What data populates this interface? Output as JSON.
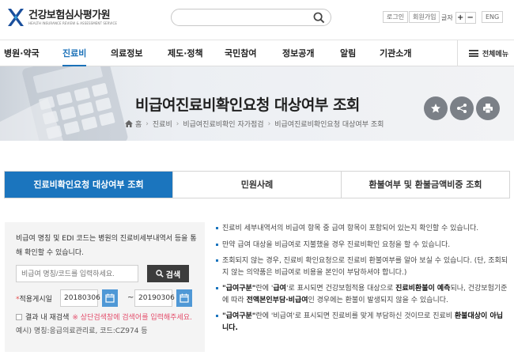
{
  "header": {
    "logo_kor": "건강보험심사평가원",
    "logo_eng": "HEALTH INSURANCE REVIEW & ASSESSMENT SERVICE",
    "search_placeholder": "",
    "login": "로그인",
    "join": "회원가입",
    "font_size_label": "글자",
    "font_plus": "+",
    "font_minus": "−",
    "lang": "ENG"
  },
  "nav": {
    "items": [
      "병원·약국",
      "진료비",
      "의료정보",
      "제도·정책",
      "국민참여",
      "정보공개",
      "알림",
      "기관소개"
    ],
    "active_index": 1,
    "all_menu": "전체메뉴"
  },
  "banner": {
    "title": "비급여진료비확인요청 대상여부 조회",
    "breadcrumb": [
      "홈",
      "진료비",
      "비급여진료비확인 자가점검",
      "비급여진료비확인요청 대상여부 조회"
    ]
  },
  "icons": {
    "favorite": "star-icon",
    "share": "share-icon",
    "print": "print-icon"
  },
  "tabs": [
    "진료비확인요청 대상여부 조회",
    "민원사례",
    "환불여부 및 환불금액비중 조회"
  ],
  "search_panel": {
    "description": "비급여 명칭 및 EDI 코드는 병원의 진료비세부내역서 등을 통해 확인할 수 있습니다.",
    "keyword_placeholder": "비급여 명칭/코드를 입력하세요.",
    "search_button": "검색",
    "date_label_star": "*",
    "date_label": "적용게시일",
    "date_from": "20180306",
    "date_to": "20190306",
    "tilde": "~",
    "checkbox_label": "결과 내 재검색",
    "checkbox_warning": "※ 상단검색창에 검색어를 입력해주세요.",
    "example": "예시) 명칭:응급의료관리료, 코드:CZ974 등"
  },
  "info": [
    {
      "plain": "진료비 세부내역서의 비급여 항목 중 급여 항목이 포함되어 있는지 확인할 수 있습니다."
    },
    {
      "plain": "만약 급여 대상을 비급여로 지불했을 경우 진료비확인 요청을 할 수 있습니다."
    },
    {
      "plain": "조회되지 않는 경우, 진료비 확인요청으로 진료비 환불여부를 알아 보실 수 있습니다. (단, 조회되지 않는 의약품은 비급여로 비용을 본인이 부담하셔야 합니다.)"
    },
    {
      "b1": "\"급여구분\"",
      "t1": "란에 '",
      "b2": "급여",
      "t2": "'로 표시되면 건강보험적용 대상으로 ",
      "b3": "진료비환불이 예측",
      "t3": "되나, 건강보험기준에 따라 ",
      "b4": "전액본인부담·비급여",
      "t4": "인 경우에는 환불이 발생되지 않을 수 있습니다."
    },
    {
      "b1": "\"급여구분\"",
      "t1": "란에 '비급여'로 표시되면 진료비를 맞게 부담하신 것이므로 진료비 ",
      "b2": "환불대상이 아닙니다."
    }
  ]
}
